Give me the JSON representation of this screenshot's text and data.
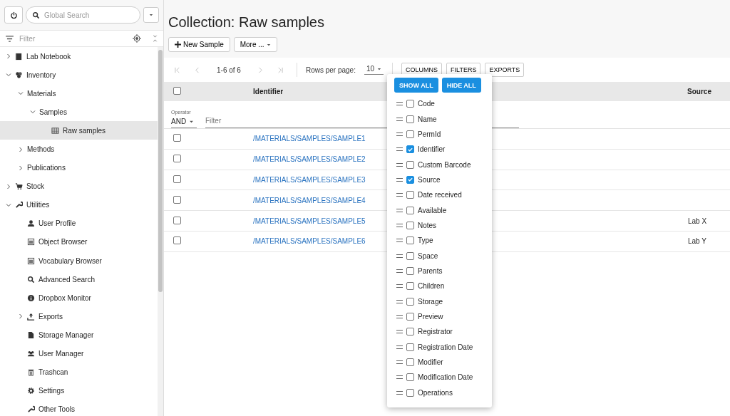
{
  "search": {
    "placeholder": "Global Search"
  },
  "sidebar": {
    "filter": {
      "placeholder": "Filter"
    },
    "tree": [
      {
        "label": "Lab Notebook",
        "expanded": false,
        "selected": false
      },
      {
        "label": "Inventory",
        "expanded": true,
        "selected": false,
        "children": [
          {
            "label": "Materials",
            "expanded": true,
            "selected": false,
            "children": [
              {
                "label": "Samples",
                "expanded": true,
                "selected": false,
                "children": [
                  {
                    "label": "Raw samples",
                    "selected": true
                  }
                ]
              }
            ]
          },
          {
            "label": "Methods",
            "expanded": false,
            "selected": false
          },
          {
            "label": "Publications",
            "expanded": false,
            "selected": false
          }
        ]
      },
      {
        "label": "Stock",
        "expanded": false,
        "selected": false
      },
      {
        "label": "Utilities",
        "expanded": true,
        "selected": false,
        "children": [
          {
            "label": "User Profile",
            "selected": false
          },
          {
            "label": "Object Browser",
            "selected": false
          },
          {
            "label": "Vocabulary Browser",
            "selected": false
          },
          {
            "label": "Advanced Search",
            "selected": false
          },
          {
            "label": "Dropbox Monitor",
            "selected": false
          },
          {
            "label": "Exports",
            "expanded": false,
            "selected": false
          },
          {
            "label": "Storage Manager",
            "selected": false
          },
          {
            "label": "User Manager",
            "selected": false
          },
          {
            "label": "Trashcan",
            "selected": false
          },
          {
            "label": "Settings",
            "selected": false
          },
          {
            "label": "Other Tools",
            "selected": false
          }
        ]
      }
    ]
  },
  "title": "Collection: Raw samples",
  "actions": [
    {
      "label": "New Sample",
      "kind": "add"
    },
    {
      "label": "More ...",
      "kind": "menu"
    }
  ],
  "pagination": {
    "range": "1-6 of 6",
    "rows_per_page_label": "Rows per page:",
    "rows_per_page": "10"
  },
  "toolbar": [
    "COLUMNS",
    "FILTERS",
    "EXPORTS"
  ],
  "table": {
    "all_checked": false,
    "columns": [
      "Identifier",
      "Source"
    ],
    "filter": {
      "operator_label": "Operator",
      "operator": "AND",
      "placeholder": "Filter"
    },
    "rows": [
      {
        "checked": false,
        "identifier": "/MATERIALS/SAMPLES/SAMPLE1"
      },
      {
        "checked": false,
        "identifier": "/MATERIALS/SAMPLES/SAMPLE2"
      },
      {
        "checked": false,
        "identifier": "/MATERIALS/SAMPLES/SAMPLE3"
      },
      {
        "checked": false,
        "identifier": "/MATERIALS/SAMPLES/SAMPLE4"
      },
      {
        "checked": false,
        "identifier": "/MATERIALS/SAMPLES/SAMPLE5",
        "source": "Lab X"
      },
      {
        "checked": false,
        "identifier": "/MATERIALS/SAMPLES/SAMPLE6",
        "source": "Lab Y"
      }
    ]
  },
  "columns_popup": {
    "buttons": [
      "SHOW ALL",
      "HIDE ALL"
    ],
    "columns": [
      {
        "label": "Code",
        "checked": false
      },
      {
        "label": "Name",
        "checked": false
      },
      {
        "label": "PermId",
        "checked": false
      },
      {
        "label": "Identifier",
        "checked": true
      },
      {
        "label": "Custom Barcode",
        "checked": false
      },
      {
        "label": "Source",
        "checked": true
      },
      {
        "label": "Date received",
        "checked": false
      },
      {
        "label": "Available",
        "checked": false
      },
      {
        "label": "Notes",
        "checked": false
      },
      {
        "label": "Type",
        "checked": false
      },
      {
        "label": "Space",
        "checked": false
      },
      {
        "label": "Parents",
        "checked": false
      },
      {
        "label": "Children",
        "checked": false
      },
      {
        "label": "Storage",
        "checked": false
      },
      {
        "label": "Preview",
        "checked": false
      },
      {
        "label": "Registrator",
        "checked": false
      },
      {
        "label": "Registration Date",
        "checked": false
      },
      {
        "label": "Modifier",
        "checked": false
      },
      {
        "label": "Modification Date",
        "checked": false
      },
      {
        "label": "Operations",
        "checked": false
      }
    ]
  }
}
